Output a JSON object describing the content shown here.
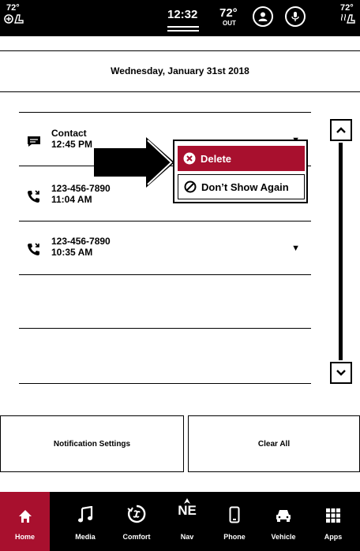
{
  "status_bar": {
    "temp_left": "72°",
    "time": "12:32",
    "outside_temp": "72°",
    "outside_label": "OUT",
    "temp_right": "72°",
    "icons": [
      "seat-heat-icon",
      "user-icon",
      "microphone-icon",
      "seat-heat-icon"
    ]
  },
  "date": "Wednesday, January 31st 2018",
  "notifications": [
    {
      "icon": "message-icon",
      "title": "Contact",
      "time": "12:45 PM"
    },
    {
      "icon": "missed-call-icon",
      "title": "123-456-7890",
      "time": "11:04 AM"
    },
    {
      "icon": "missed-call-icon",
      "title": "123-456-7890",
      "time": "10:35 AM"
    }
  ],
  "context_menu": {
    "delete_label": "Delete",
    "dont_show_label": "Don’t Show Again"
  },
  "buttons": {
    "notification_settings": "Notification Settings",
    "clear_all": "Clear All"
  },
  "nav": [
    {
      "label": "Home",
      "icon": "home-icon",
      "active": true
    },
    {
      "label": "Media",
      "icon": "music-note-icon",
      "active": false
    },
    {
      "label": "Comfort",
      "icon": "climate-icon",
      "active": false
    },
    {
      "label": "Nav",
      "icon": "compass-icon",
      "active": false
    },
    {
      "label": "Phone",
      "icon": "phone-icon",
      "active": false
    },
    {
      "label": "Vehicle",
      "icon": "car-icon",
      "active": false
    },
    {
      "label": "Apps",
      "icon": "apps-grid-icon",
      "active": false
    }
  ],
  "colors": {
    "accent": "#a8102e",
    "bar_background": "#000000",
    "page_background": "#ffffff"
  }
}
